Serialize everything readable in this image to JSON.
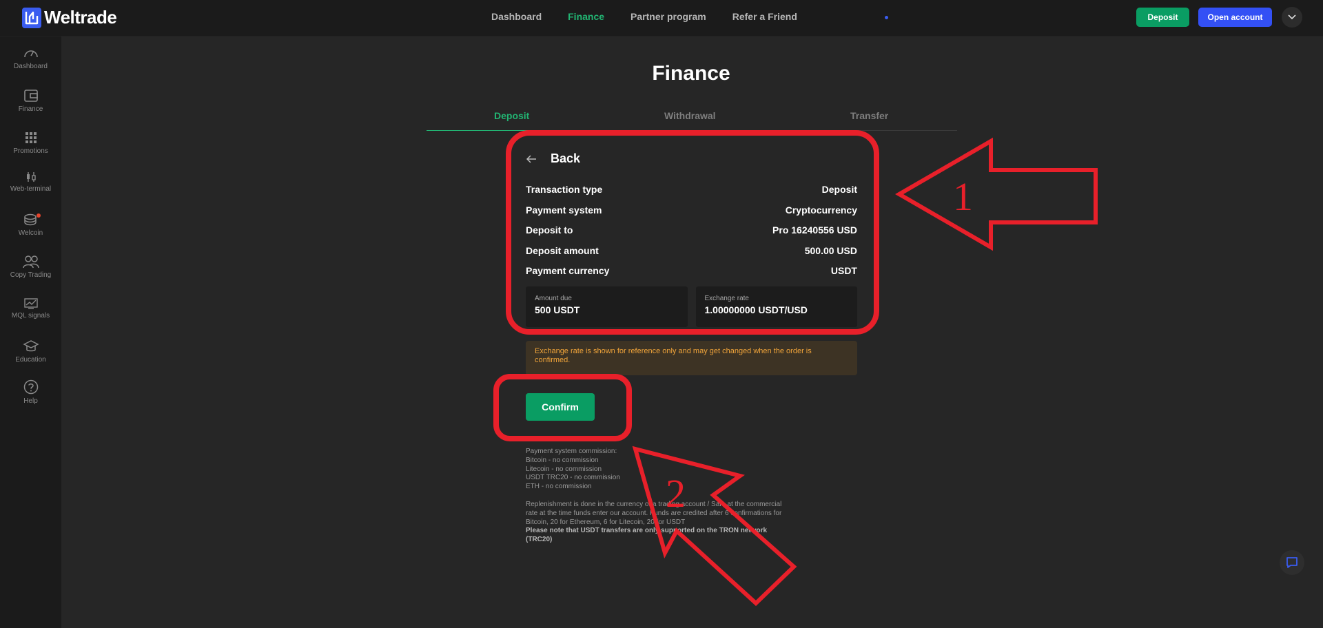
{
  "brand": {
    "name": "Weltrade"
  },
  "nav": [
    {
      "label": "Dashboard",
      "active": false
    },
    {
      "label": "Finance",
      "active": true
    },
    {
      "label": "Partner program",
      "active": false
    },
    {
      "label": "Refer a Friend",
      "active": false
    }
  ],
  "header": {
    "deposit_label": "Deposit",
    "open_account_label": "Open account"
  },
  "sidebar": [
    {
      "label": "Dashboard",
      "icon": "speedometer-icon"
    },
    {
      "label": "Finance",
      "icon": "wallet-icon"
    },
    {
      "label": "Promotions",
      "icon": "grid-icon"
    },
    {
      "label": "Web-terminal",
      "icon": "candlestick-icon"
    },
    {
      "label": "Welcoin",
      "icon": "coins-icon"
    },
    {
      "label": "Copy Trading",
      "icon": "users-icon"
    },
    {
      "label": "MQL signals",
      "icon": "signal-chart-icon"
    },
    {
      "label": "Education",
      "icon": "graduation-cap-icon"
    },
    {
      "label": "Help",
      "icon": "help-icon"
    }
  ],
  "page": {
    "title": "Finance"
  },
  "tabs": [
    {
      "label": "Deposit",
      "active": true
    },
    {
      "label": "Withdrawal",
      "active": false
    },
    {
      "label": "Transfer",
      "active": false
    }
  ],
  "form": {
    "back_label": "Back",
    "rows": [
      {
        "label": "Transaction type",
        "value": "Deposit"
      },
      {
        "label": "Payment system",
        "value": "Cryptocurrency"
      },
      {
        "label": "Deposit to",
        "value": "Pro 16240556 USD"
      },
      {
        "label": "Deposit amount",
        "value": "500.00 USD"
      },
      {
        "label": "Payment currency",
        "value": "USDT"
      }
    ],
    "amount_due": {
      "label": "Amount due",
      "value": "500 USDT"
    },
    "exchange_rate": {
      "label": "Exchange rate",
      "value": "1.00000000 USDT/USD"
    },
    "warning": "Exchange rate is shown for reference only and may get changed when the order is confirmed.",
    "confirm_label": "Confirm"
  },
  "notes": {
    "commission_lines": [
      "Payment system commission:",
      "Bitcoin - no commission",
      "Litecoin - no commission",
      "USDT TRC20 - no commission",
      "ETH - no commission"
    ],
    "replenishment_text": "Replenishment is done in the currency of a trading account / Safe at the commercial rate at the time funds enter our account. Funds are credited after 6 confirmations for Bitcoin, 20 for Ethereum, 6 for Litecoin, 20 for USDT",
    "tron_note": "Please note that USDT transfers are only supported on the TRON network (TRC20)"
  },
  "annotations": {
    "label_1": "1",
    "label_2": "2",
    "color": "#e8202a"
  },
  "colors": {
    "accent_green": "#22b573",
    "button_green": "#0a9d63",
    "brand_blue": "#3350f5",
    "warning_text": "#f0a43a"
  }
}
